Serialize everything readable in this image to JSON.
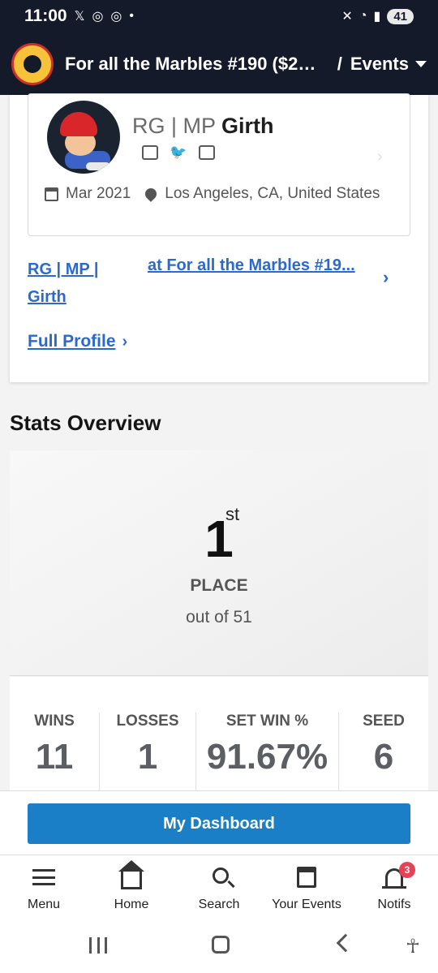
{
  "status_bar": {
    "time": "11:00",
    "left_icons": [
      "x-icon",
      "instagram-icon",
      "instagram-icon",
      "dot-icon"
    ],
    "battery": "41"
  },
  "header": {
    "title": "For all the Marbles #190 ($20 ...",
    "separator": "/",
    "section": "Events"
  },
  "profile": {
    "prefix": "RG | MP",
    "name": "Girth",
    "socials": [
      "twitch-icon",
      "twitter-icon",
      "discord-icon"
    ],
    "joined": "Mar 2021",
    "location": "Los Angeles, CA, United States"
  },
  "breadcrumb": {
    "user": "RG | MP | Girth",
    "event": "at For all the Marbles #19..."
  },
  "full_profile_label": "Full Profile",
  "stats": {
    "title": "Stats Overview",
    "place_number": "1",
    "place_suffix": "st",
    "place_label": "PLACE",
    "place_sub": "out of 51",
    "items": [
      {
        "label": "WINS",
        "value": "11"
      },
      {
        "label": "LOSSES",
        "value": "1"
      },
      {
        "label": "SET WIN %",
        "value": "91.67%"
      },
      {
        "label": "SEED",
        "value": "6"
      }
    ]
  },
  "dashboard_label": "My Dashboard",
  "bottom_nav": {
    "items": [
      {
        "label": "Menu"
      },
      {
        "label": "Home"
      },
      {
        "label": "Search"
      },
      {
        "label": "Your Events"
      },
      {
        "label": "Notifs"
      }
    ],
    "notif_count": "3"
  },
  "colors": {
    "header_bg": "#151a2a",
    "link": "#2a6ad0",
    "primary_button": "#1a7fc6",
    "badge": "#e64255"
  }
}
